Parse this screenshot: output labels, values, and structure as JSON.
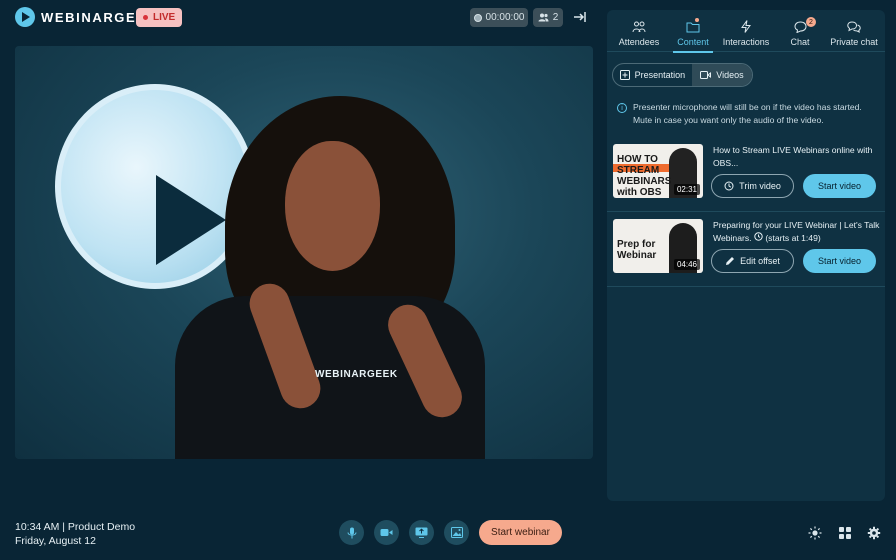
{
  "header": {
    "brand": "WEBINARGEEK",
    "live_label": "LIVE",
    "timer": "00:00:00",
    "attendee_count": "2"
  },
  "stage": {
    "shirt_logo": "WEBINARGEEK"
  },
  "footer": {
    "time_line": "10:34 AM | Product Demo",
    "date_line": "Friday, August 12",
    "start_label": "Start webinar"
  },
  "panel": {
    "tabs": [
      {
        "label": "Attendees",
        "icon": "attendees-icon"
      },
      {
        "label": "Content",
        "icon": "folder-icon",
        "active": true
      },
      {
        "label": "Interactions",
        "icon": "lightning-icon"
      },
      {
        "label": "Chat",
        "icon": "chat-icon",
        "badge": "2"
      },
      {
        "label": "Private chat",
        "icon": "private-chat-icon"
      }
    ],
    "content_tabs": [
      "Presentation",
      "Videos"
    ],
    "notice": "Presenter microphone will still be on if the video has started. Mute in case you want only the audio of the video.",
    "videos": [
      {
        "title": "How to Stream LIVE Webinars online with OBS...",
        "thumb_text": "HOW TO STREAM WEBINARS with OBS",
        "duration": "02:31",
        "secondary_action": "Trim video",
        "primary_action": "Start video"
      },
      {
        "title": "Preparing for your LIVE Webinar | Let's Talk Webinars.",
        "start_note": "(starts at 1:49)",
        "thumb_text": "Prep for Webinar",
        "duration": "04:46",
        "secondary_action": "Edit offset",
        "primary_action": "Start video"
      }
    ]
  },
  "colors": {
    "background": "#092535",
    "panel": "#0f3142",
    "accent": "#5fc7ea",
    "start_button": "#f6a98d",
    "live_badge": "#f6c1c1"
  }
}
